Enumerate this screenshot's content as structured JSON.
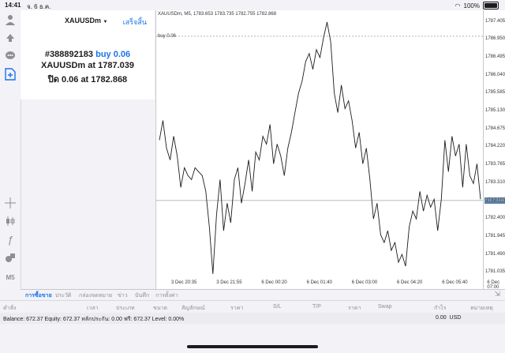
{
  "status": {
    "time": "14:41",
    "date": "จ. 6 ธ.ค.",
    "battery": "100%"
  },
  "panel": {
    "symbol": "XAUUSDm",
    "done_label": "เสร็จสิ้น",
    "ticket": "#388892183",
    "order_type": "buy 0.06",
    "open_line": "XAUUSDm at",
    "open_price": "1787.039",
    "close_line": "ปิด 0.06 at",
    "close_price": "1782.868"
  },
  "chart_header": "XAUUSDm, M5, 1783.653 1783.735 1782.755 1782.868",
  "buy_label": "buy 0.06",
  "current_price_tag": "1782.868",
  "chart_data": {
    "type": "line",
    "symbol": "XAUUSDm",
    "timeframe": "M5",
    "x_ticks": [
      "3 Dec 20:35",
      "3 Dec 21:55",
      "6 Dec 00:20",
      "6 Dec 01:40",
      "6 Dec 03:00",
      "6 Dec 04:20",
      "6 Dec 05:40",
      "6 Dec 07:00"
    ],
    "y_ticks": [
      1787.405,
      1786.95,
      1786.495,
      1786.04,
      1785.585,
      1785.13,
      1784.675,
      1784.22,
      1783.765,
      1783.31,
      1782.855,
      1782.4,
      1781.945,
      1781.49,
      1781.035
    ],
    "ylim": [
      1780.78,
      1787.7
    ],
    "open_price": 1787.039,
    "current_price": 1782.868,
    "values": [
      1784.4,
      1784.9,
      1784.2,
      1783.9,
      1784.5,
      1784.0,
      1783.2,
      1783.7,
      1783.5,
      1783.4,
      1783.7,
      1783.6,
      1783.5,
      1783.1,
      1782.2,
      1781.0,
      1782.5,
      1783.4,
      1782.1,
      1782.8,
      1782.3,
      1783.4,
      1783.7,
      1782.8,
      1783.3,
      1783.9,
      1783.1,
      1784.1,
      1783.9,
      1784.5,
      1784.3,
      1784.8,
      1783.8,
      1784.3,
      1784.0,
      1783.5,
      1784.2,
      1784.6,
      1785.1,
      1785.6,
      1785.9,
      1786.4,
      1786.6,
      1786.2,
      1786.7,
      1786.5,
      1787.0,
      1787.4,
      1786.9,
      1785.6,
      1785.1,
      1785.8,
      1785.2,
      1785.4,
      1784.9,
      1784.2,
      1784.6,
      1783.8,
      1784.2,
      1783.4,
      1782.4,
      1782.8,
      1782.0,
      1781.8,
      1782.1,
      1781.6,
      1781.8,
      1781.3,
      1781.5,
      1781.2,
      1782.2,
      1782.6,
      1782.4,
      1783.1,
      1782.6,
      1783.0,
      1782.7,
      1782.9,
      1782.1,
      1782.9,
      1784.4,
      1783.6,
      1784.5,
      1784.0,
      1784.3,
      1783.2,
      1784.3,
      1783.5,
      1783.3,
      1783.8,
      1782.9
    ]
  },
  "tabs": [
    "การซื้อขาย",
    "ประวัติ",
    "กล่องจดหมาย",
    "ข่าว",
    "บันทึก",
    "การตั้งค่า"
  ],
  "active_tab": "การซื้อขาย",
  "columns": [
    "คำสั่ง",
    "เวลา",
    "ประเภท",
    "ขนาด",
    "สัญลักษณ์",
    "ราคา",
    "S/L",
    "T/P",
    "ราคา",
    "Swap",
    "กำไร",
    "หมายเหตุ"
  ],
  "balance": {
    "text": "Balance: 672.37 Equity: 672.37 หลักประกัน: 0.00 ฟรี: 672.37 Level: 0.00%",
    "profit": "0.00",
    "currency": "USD"
  },
  "icons": [
    "person-icon",
    "arrows-icon",
    "chat-icon",
    "new-order-icon",
    "crosshair-icon",
    "candles-icon",
    "function-icon",
    "objects-icon",
    "timeframe-label"
  ]
}
